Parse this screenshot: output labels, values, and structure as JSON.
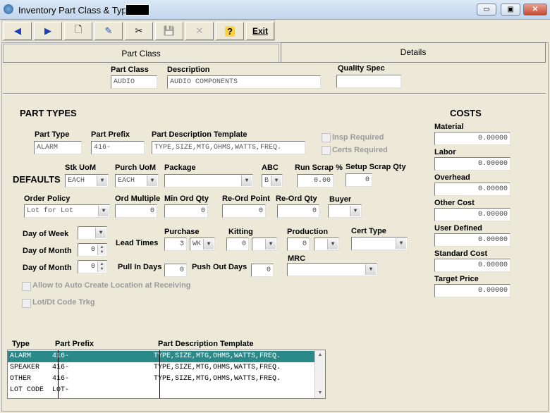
{
  "window": {
    "title": "Inventory Part Class & Type",
    "min_glyph": "▭",
    "max_glyph": "▣",
    "close_glyph": "✕"
  },
  "toolbar": {
    "prev_icon": "◀",
    "next_icon": "▶",
    "new_icon": "🗋",
    "edit_icon": "✎",
    "cut_icon": "✂",
    "save_icon": "💾",
    "delete_icon": "✕",
    "help_icon": "?",
    "exit_label": "Exit"
  },
  "tabs": {
    "part_class": "Part Class",
    "details": "Details"
  },
  "header": {
    "part_class_label": "Part Class",
    "part_class_value": "AUDIO",
    "description_label": "Description",
    "description_value": "AUDIO COMPONENTS",
    "quality_spec_label": "Quality Spec",
    "quality_spec_value": ""
  },
  "part_types": {
    "title": "PART TYPES",
    "part_type_label": "Part Type",
    "part_type_value": "ALARM",
    "part_prefix_label": "Part Prefix",
    "part_prefix_value": "416-",
    "template_label": "Part Description Template",
    "template_value": "TYPE,SIZE,MTG,OHMS,WATTS,FREQ.",
    "insp_required": "Insp Required",
    "certs_required": "Certs Required"
  },
  "defaults": {
    "title": "DEFAULTS",
    "stk_uom_label": "Stk UoM",
    "stk_uom_value": "EACH",
    "purch_uom_label": "Purch UoM",
    "purch_uom_value": "EACH",
    "package_label": "Package",
    "package_value": "",
    "abc_label": "ABC",
    "abc_value": "B",
    "run_scrap_label": "Run Scrap %",
    "run_scrap_value": "0.00",
    "setup_scrap_label": "Setup Scrap Qty",
    "setup_scrap_value": "0",
    "order_policy_label": "Order Policy",
    "order_policy_value": "Lot for Lot",
    "ord_multiple_label": "Ord Multiple",
    "ord_multiple_value": "0",
    "min_ord_qty_label": "Min Ord Qty",
    "min_ord_qty_value": "0",
    "reord_point_label": "Re-Ord Point",
    "reord_point_value": "0",
    "reord_qty_label": "Re-Ord Qty",
    "reord_qty_value": "0",
    "buyer_label": "Buyer",
    "buyer_value": "",
    "day_of_week_label": "Day of Week",
    "day_of_week_value": "",
    "day_of_month_label": "Day of Month",
    "day_of_month1_value": "0",
    "day_of_month2_value": "0",
    "lead_times_label": "Lead Times",
    "purchase_label": "Purchase",
    "purchase_value": "3",
    "purchase_unit": "WK",
    "kitting_label": "Kitting",
    "kitting_value": "0",
    "kitting_unit": "",
    "production_label": "Production",
    "production_value": "0",
    "production_unit": "",
    "cert_type_label": "Cert Type",
    "cert_type_value": "",
    "pull_in_days_label": "Pull In Days",
    "pull_in_days_value": "0",
    "push_out_days_label": "Push Out Days",
    "push_out_days_value": "0",
    "mrc_label": "MRC",
    "mrc_value": "",
    "auto_create_label": "Allow to Auto Create Location at Receiving",
    "lot_dt_label": "Lot/Dt Code Trkg"
  },
  "costs": {
    "title": "COSTS",
    "items": [
      {
        "label": "Material",
        "value": "0.00000"
      },
      {
        "label": "Labor",
        "value": "0.00000"
      },
      {
        "label": "Overhead",
        "value": "0.00000"
      },
      {
        "label": "Other Cost",
        "value": "0.00000"
      },
      {
        "label": "User Defined",
        "value": "0.00000"
      },
      {
        "label": "Standard Cost",
        "value": "0.00000"
      },
      {
        "label": "Target Price",
        "value": "0.00000"
      }
    ]
  },
  "grid": {
    "headers": {
      "type": "Type",
      "prefix": "Part Prefix",
      "template": "Part Description Template"
    },
    "rows": [
      {
        "type": "ALARM",
        "prefix": "416-",
        "template": "TYPE,SIZE,MTG,OHMS,WATTS,FREQ."
      },
      {
        "type": "SPEAKER",
        "prefix": "416-",
        "template": "TYPE,SIZE,MTG,OHMS,WATTS,FREQ."
      },
      {
        "type": "OTHER",
        "prefix": "416-",
        "template": "TYPE,SIZE,MTG,OHMS,WATTS,FREQ."
      },
      {
        "type": "LOT CODE",
        "prefix": "LOT-",
        "template": ""
      }
    ],
    "up_glyph": "▲",
    "down_glyph": "▼"
  },
  "colors": {
    "selection": "#2a8a8a",
    "window_bg": "#ece9d8"
  }
}
